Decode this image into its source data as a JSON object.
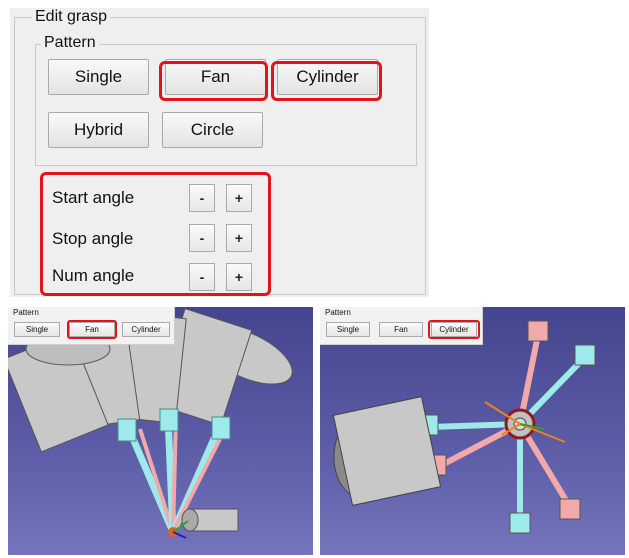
{
  "edit_grasp": {
    "title": "Edit grasp",
    "pattern": {
      "legend": "Pattern",
      "buttons": [
        "Single",
        "Fan",
        "Cylinder",
        "Hybrid",
        "Circle"
      ]
    },
    "angles": [
      {
        "label": "Start angle",
        "minus": "-",
        "plus": "+"
      },
      {
        "label": "Stop angle",
        "minus": "-",
        "plus": "+"
      },
      {
        "label": "Num angle",
        "minus": "-",
        "plus": "+"
      }
    ]
  },
  "left_view": {
    "pattern_legend": "Pattern",
    "buttons": [
      "Single",
      "Fan",
      "Cylinder"
    ],
    "selected": "Fan"
  },
  "right_view": {
    "pattern_legend": "Pattern",
    "buttons": [
      "Single",
      "Fan",
      "Cylinder"
    ],
    "selected": "Cylinder"
  },
  "colors": {
    "highlight": "#e1141b",
    "scene_bg": "#4d4d9a",
    "gripper_body": "#c9c9c9",
    "finger_cyan": "#9eeaea",
    "finger_pink": "#f2a9a9"
  }
}
